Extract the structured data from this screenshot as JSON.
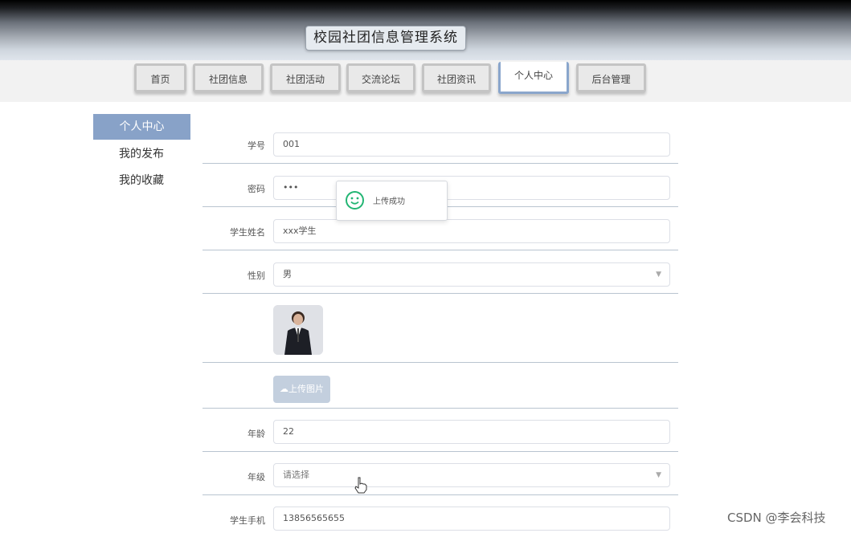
{
  "app": {
    "title": "校园社团信息管理系统"
  },
  "nav": {
    "items": [
      {
        "label": "首页"
      },
      {
        "label": "社团信息"
      },
      {
        "label": "社团活动"
      },
      {
        "label": "交流论坛"
      },
      {
        "label": "社团资讯"
      },
      {
        "label": "个人中心"
      },
      {
        "label": "后台管理"
      }
    ],
    "active": "个人中心"
  },
  "sidebar": {
    "items": [
      {
        "label": "个人中心"
      },
      {
        "label": "我的发布"
      },
      {
        "label": "我的收藏"
      }
    ],
    "active": "个人中心"
  },
  "form": {
    "student_id": {
      "label": "学号",
      "value": "001"
    },
    "password": {
      "label": "密码",
      "value": "•••"
    },
    "student_name": {
      "label": "学生姓名",
      "value": "xxx学生"
    },
    "gender": {
      "label": "性别",
      "value": "男"
    },
    "upload": {
      "label": "上传图片",
      "icon": "cloud-upload-icon"
    },
    "age": {
      "label": "年龄",
      "value": "22"
    },
    "grade": {
      "label": "年级",
      "value": "请选择"
    },
    "phone": {
      "label": "学生手机",
      "value": "13856565655"
    }
  },
  "toast": {
    "text": "上传成功",
    "icon": "smile-icon",
    "color": "#22b573"
  },
  "colors": {
    "accent": "#88a2c8",
    "nav_active_border": "#8aa6cc"
  },
  "watermark": "CSDN @李会科技"
}
